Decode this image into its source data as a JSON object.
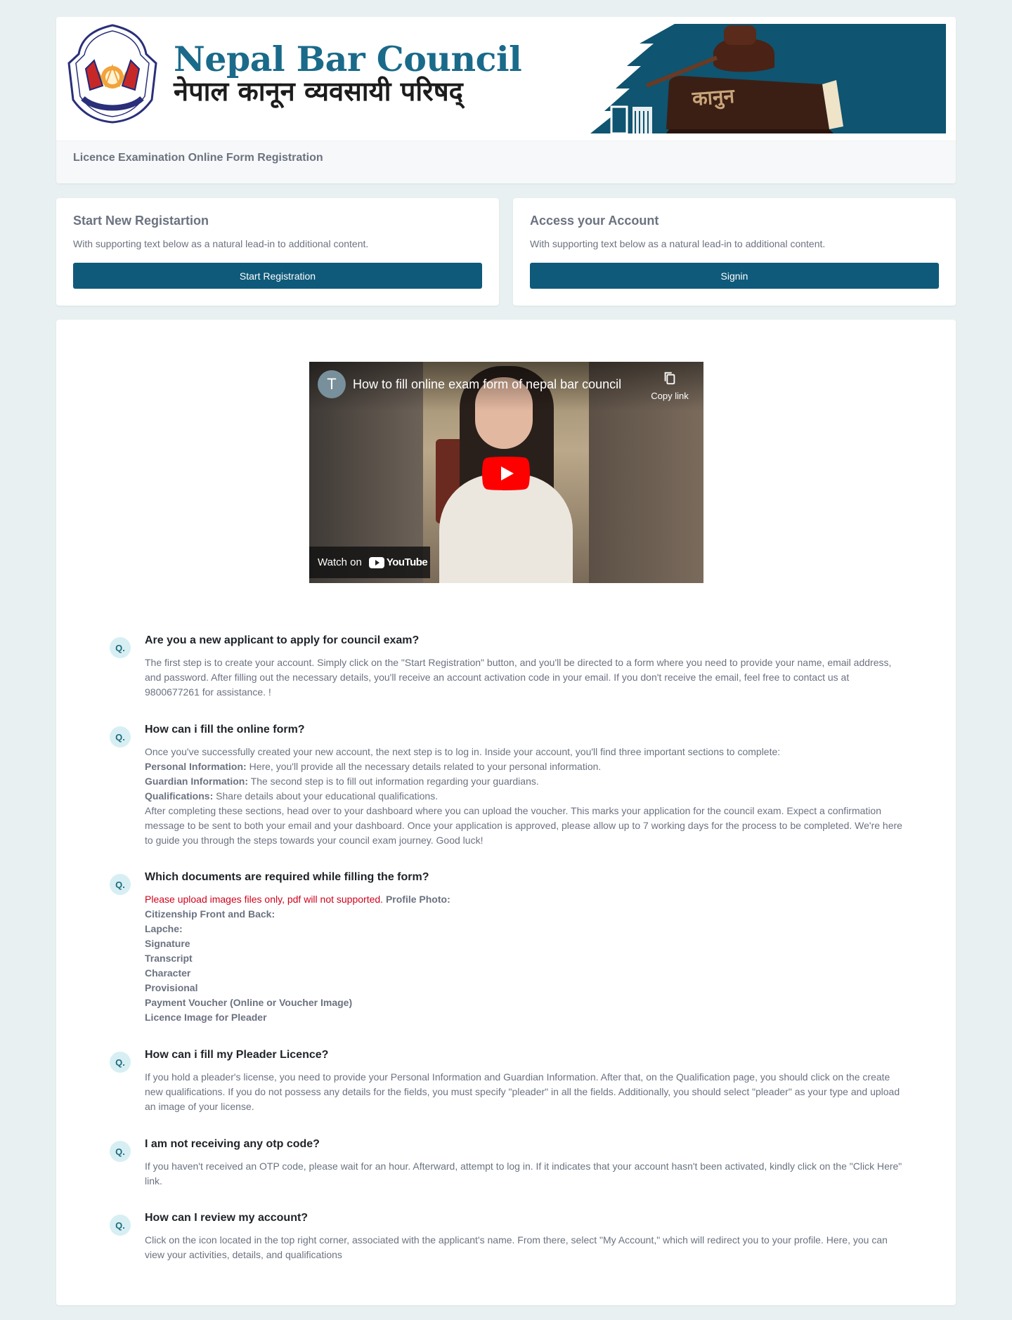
{
  "header": {
    "brand_en": "Nepal Bar Council",
    "brand_np": "नेपाल कानून व्यवसायी परिषद्",
    "logo_caption": "NEPAL BAR COUNCIL 1953",
    "banner_word": "कानुन",
    "subtitle": "Licence Examination Online Form Registration"
  },
  "cards": {
    "register": {
      "title": "Start New Registartion",
      "text": "With supporting text below as a natural lead-in to additional content.",
      "button": "Start Registration"
    },
    "access": {
      "title": "Access your Account",
      "text": "With supporting text below as a natural lead-in to additional content.",
      "button": "Signin"
    }
  },
  "video": {
    "channel_initial": "T",
    "title": "How to fill online exam form of nepal bar council",
    "copy_label": "Copy link",
    "watch_label": "Watch on",
    "youtube_label": "YouTube"
  },
  "faq": {
    "badge": "Q.",
    "items": [
      {
        "question": "Are you a new applicant to apply for council exam?",
        "answer": "The first step is to create your account. Simply click on the \"Start Registration\" button, and you'll be directed to a form where you need to provide your name, email address, and password. After filling out the necessary details, you'll receive an account activation code in your email. If you don't receive the email, feel free to contact us at 9800677261 for assistance. !"
      },
      {
        "question": "How can i fill the online form?",
        "intro": "Once you've successfully created your new account, the next step is to log in. Inside your account, you'll find three important sections to complete:",
        "sections": [
          {
            "label": "Personal Information:",
            "text": "Here, you'll provide all the necessary details related to your personal information."
          },
          {
            "label": "Guardian Information:",
            "text": "The second step is to fill out information regarding your guardians."
          },
          {
            "label": "Qualifications:",
            "text": "Share details about your educational qualifications."
          }
        ],
        "outro": "After completing these sections, head over to your dashboard where you can upload the voucher. This marks your application for the council exam. Expect a confirmation message to be sent to both your email and your dashboard. Once your application is approved, please allow up to 7 working days for the process to be completed. We're here to guide you through the steps towards your council exam journey. Good luck!"
      },
      {
        "question": "Which documents are required while filling the form?",
        "warning": "Please upload images files only, pdf will not supported.",
        "first_doc": "Profile Photo:",
        "documents": [
          "Citizenship Front and Back:",
          "Lapche:",
          "Signature",
          "Transcript",
          "Character",
          "Provisional",
          "Payment Voucher (Online or Voucher Image)",
          "Licence Image for Pleader"
        ]
      },
      {
        "question": "How can i fill my Pleader Licence?",
        "answer": "If you hold a pleader's license, you need to provide your Personal Information and Guardian Information. After that, on the Qualification page, you should click on the create new qualifications. If you do not possess any details for the fields, you must specify \"pleader\" in all the fields. Additionally, you should select \"pleader\" as your type and upload an image of your license."
      },
      {
        "question": "I am not receiving any otp code?",
        "answer": "If you haven't received an OTP code, please wait for an hour. Afterward, attempt to log in. If it indicates that your account hasn't been activated, kindly click on the \"Click Here\" link."
      },
      {
        "question": "How can I review my account?",
        "answer": "Click on the icon located in the top right corner, associated with the applicant's name. From there, select \"My Account,\" which will redirect you to your profile. Here, you can view your activities, details, and qualifications"
      }
    ]
  },
  "colors": {
    "primary": "#0f5a7a",
    "brand_blue": "#1a6a8a",
    "page_bg": "#e8f0f1",
    "badge_bg": "#d7eff3",
    "warning": "#d0021b"
  }
}
